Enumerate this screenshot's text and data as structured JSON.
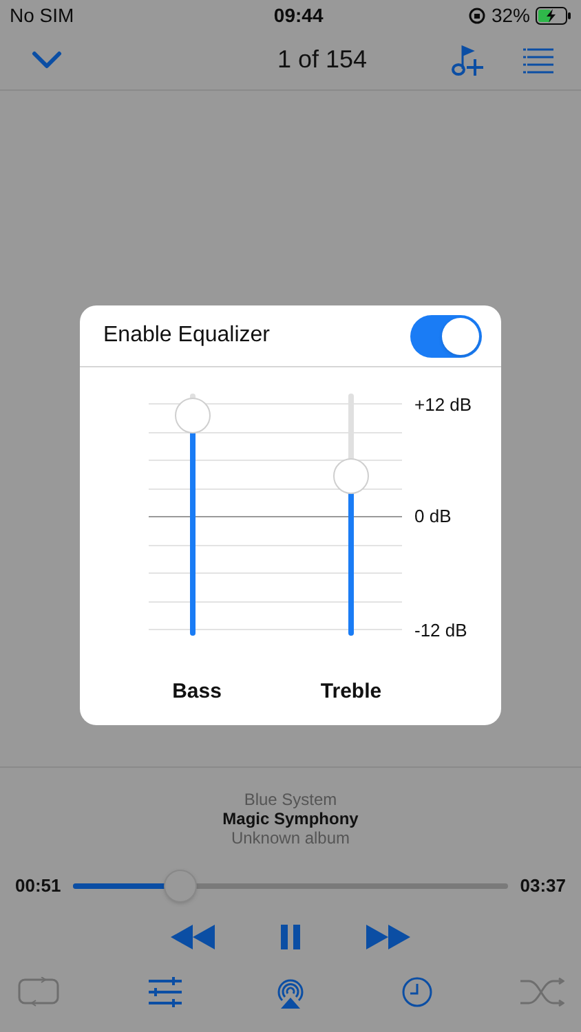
{
  "status_bar": {
    "carrier": "No SIM",
    "time": "09:44",
    "battery": "32%"
  },
  "nav_bar": {
    "title": "1 of 154"
  },
  "equalizer_dialog": {
    "title": "Enable Equalizer",
    "enabled": true,
    "scale_labels": [
      "+12 dB",
      "0 dB",
      "-12 dB"
    ],
    "bands": [
      {
        "label": "Bass",
        "level": 0.91
      },
      {
        "label": "Treble",
        "level": 0.66
      }
    ]
  },
  "now_playing": {
    "artist": "Blue System",
    "title": "Magic Symphony",
    "album": "Unknown album"
  },
  "progress": {
    "elapsed": "00:51",
    "level": 0.245,
    "duration": "03:37"
  },
  "playback_controls": [
    {
      "kind": "rewind"
    },
    {
      "kind": "pause"
    },
    {
      "kind": "forward"
    }
  ],
  "toolbar": [
    {
      "kind": "repeat",
      "on": false
    },
    {
      "kind": "equalizer",
      "on": true
    },
    {
      "kind": "airplay",
      "on": true
    },
    {
      "kind": "timer",
      "on": true
    },
    {
      "kind": "shuffle",
      "on": false
    }
  ]
}
